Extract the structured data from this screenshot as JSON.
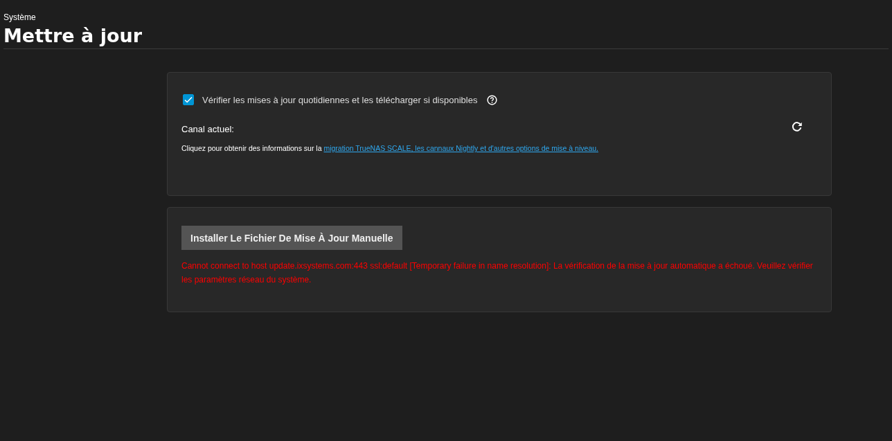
{
  "breadcrumb": "Système",
  "title": "Mettre à jour",
  "auto_check": {
    "label": "Vérifier les mises à jour quotidiennes et les télécharger si disponibles",
    "checked": true
  },
  "channel_label": "Canal actuel:",
  "info": {
    "text": "Cliquez pour obtenir des informations sur la",
    "link": "migration TrueNAS SCALE, les cannaux Nightly et d'autres options de mise à niveau."
  },
  "manual_button": "Installer Le Fichier De Mise À Jour Manuelle",
  "error": "Cannot connect to host update.ixsystems.com:443 ssl:default [Temporary failure in name resolution]: La vérification de la mise à jour automatique a échoué. Veuillez vérifier les paramètres réseau du système."
}
